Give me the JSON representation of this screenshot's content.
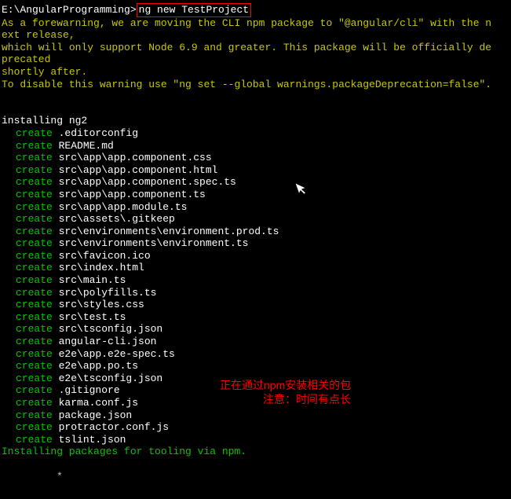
{
  "prompt": "E:\\AngularProgramming>",
  "command": "ng new TestProject",
  "warning": {
    "line1": "As a forewarning, we are moving the CLI npm package to \"@angular/cli\" with the n",
    "line2": "ext release,",
    "line3": "which will only support Node 6.9 and greater. This package will be officially de",
    "line4": "precated",
    "line5": "shortly after.",
    "line6": "",
    "line7": "To disable this warning use \"ng set --global warnings.packageDeprecation=false\"."
  },
  "installHeader": "installing ng2",
  "createLabel": "create",
  "files": [
    ".editorconfig",
    "README.md",
    "src\\app\\app.component.css",
    "src\\app\\app.component.html",
    "src\\app\\app.component.spec.ts",
    "src\\app\\app.component.ts",
    "src\\app\\app.module.ts",
    "src\\assets\\.gitkeep",
    "src\\environments\\environment.prod.ts",
    "src\\environments\\environment.ts",
    "src\\favicon.ico",
    "src\\index.html",
    "src\\main.ts",
    "src\\polyfills.ts",
    "src\\styles.css",
    "src\\test.ts",
    "src\\tsconfig.json",
    "angular-cli.json",
    "e2e\\app.e2e-spec.ts",
    "e2e\\app.po.ts",
    "e2e\\tsconfig.json",
    ".gitignore",
    "karma.conf.js",
    "package.json",
    "protractor.conf.js",
    "tslint.json"
  ],
  "installingMsg": "Installing packages for tooling via npm.",
  "annotation": {
    "line1": "正在通过npm安装相关的包",
    "line2": "注意：时间有点长"
  },
  "cursor": "*"
}
